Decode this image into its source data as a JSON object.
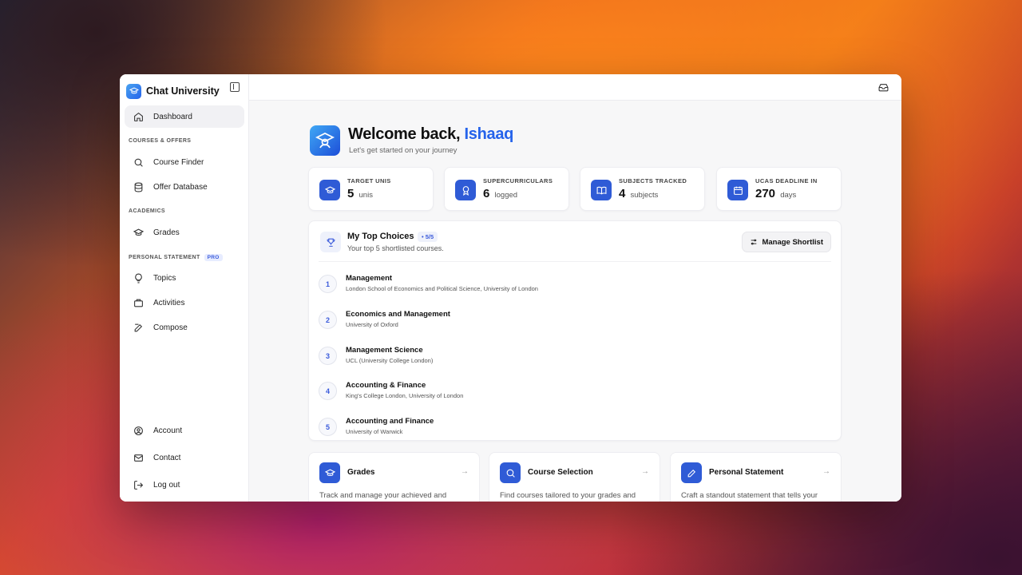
{
  "brand": {
    "name": "Chat University"
  },
  "sidebar": {
    "dashboard": "Dashboard",
    "sections": {
      "courses": "COURSES & OFFERS",
      "academics": "ACADEMICS",
      "statement": "PERSONAL STATEMENT",
      "pro_badge": "PRO"
    },
    "items": {
      "course_finder": "Course Finder",
      "offer_database": "Offer Database",
      "grades": "Grades",
      "topics": "Topics",
      "activities": "Activities",
      "compose": "Compose"
    },
    "footer": {
      "account": "Account",
      "contact": "Contact",
      "logout": "Log out"
    }
  },
  "welcome": {
    "title_prefix": "Welcome back,",
    "name": "Ishaaq",
    "subtitle": "Let's get started on your journey"
  },
  "stats": [
    {
      "label": "TARGET UNIS",
      "value": "5",
      "unit": "unis",
      "icon": "graduation-cap-icon"
    },
    {
      "label": "SUPERCURRICULARS",
      "value": "6",
      "unit": "logged",
      "icon": "award-icon"
    },
    {
      "label": "SUBJECTS TRACKED",
      "value": "4",
      "unit": "subjects",
      "icon": "book-icon"
    },
    {
      "label": "UCAS DEADLINE IN",
      "value": "270",
      "unit": "days",
      "icon": "calendar-icon"
    }
  ],
  "choices": {
    "title": "My Top Choices",
    "badge": "• 5/5",
    "subtitle": "Your top 5 shortlisted courses.",
    "manage_label": "Manage Shortlist",
    "items": [
      {
        "num": "1",
        "course": "Management",
        "uni": "London School of Economics and Political Science, University of London"
      },
      {
        "num": "2",
        "course": "Economics and Management",
        "uni": "University of Oxford"
      },
      {
        "num": "3",
        "course": "Management Science",
        "uni": "UCL (University College London)"
      },
      {
        "num": "4",
        "course": "Accounting & Finance",
        "uni": "King's College London, University of London"
      },
      {
        "num": "5",
        "course": "Accounting and Finance",
        "uni": "University of Warwick"
      }
    ]
  },
  "cards": [
    {
      "title": "Grades",
      "desc": "Track and manage your achieved and",
      "icon": "graduation-cap-icon"
    },
    {
      "title": "Course Selection",
      "desc": "Find courses tailored to your grades and",
      "icon": "search-icon"
    },
    {
      "title": "Personal Statement",
      "desc": "Craft a standout statement that tells your",
      "icon": "pen-icon"
    }
  ],
  "colors": {
    "accent": "#2563eb",
    "icon_bg": "#2f5bd6"
  }
}
